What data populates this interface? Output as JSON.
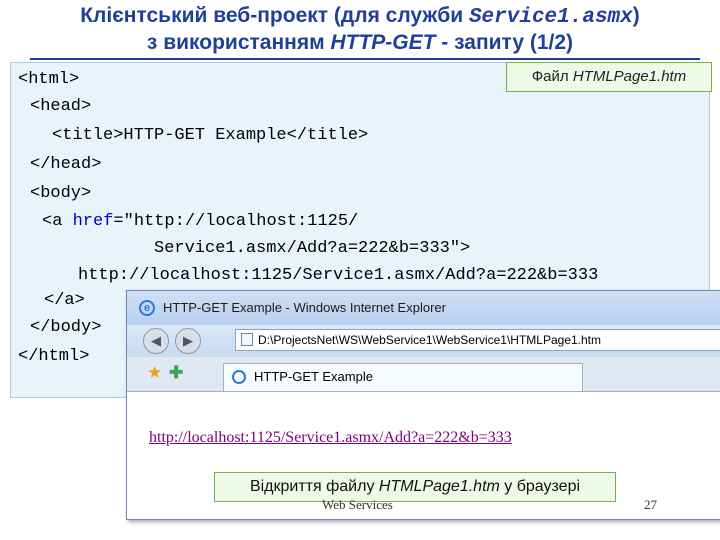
{
  "slide": {
    "title_line1_part1": "Клієнтський веб-проект (для служби ",
    "title_line1_code": "Service1.asmx",
    "title_line1_part2": ")",
    "title_line2_part1": "з використанням ",
    "title_line2_italic": "HTTP-GET",
    "title_line2_part2": " - запиту     (1/2)",
    "file_label_prefix": "Файл ",
    "file_label_name": "HTMLPage1.htm",
    "code": {
      "l1": "<html>",
      "l2": "<head>",
      "l3": "<title>HTTP-GET Example</title>",
      "l4": "</head>",
      "l5": "<body>",
      "l6_open": "<a ",
      "l6_attr": "href",
      "l6_val": "=\"http://localhost:1125/",
      "l7": "Service1.asmx/Add?a=222&b=333\">",
      "l8": "http://localhost:1125/Service1.asmx/Add?a=222&b=333",
      "l9": "</a>",
      "l10": "</body>",
      "l11": "</html>"
    },
    "caption_prefix": "Відкриття файлу ",
    "caption_file": "HTMLPage1.htm",
    "caption_suffix": " у браузері",
    "footer_left": "Web Services",
    "page_number": "27"
  },
  "browser": {
    "window_title": "HTTP-GET Example - Windows Internet Explorer",
    "address": "D:\\ProjectsNet\\WS\\WebService1\\WebService1\\HTMLPage1.htm",
    "tab_title": "HTTP-GET Example",
    "link_text": "http://localhost:1125/Service1.asmx/Add?a=222&b=333"
  },
  "colors": {
    "title": "#1f3f9a",
    "code_bg": "#e8f4fa",
    "keyword": "#0000cc",
    "label_bg": "#eef9e8",
    "label_border": "#6fb34a",
    "visited_link": "#800080"
  },
  "icons": [
    "ie-logo-icon",
    "back-icon",
    "forward-icon",
    "page-icon",
    "favorites-star-icon",
    "add-favorites-icon"
  ]
}
